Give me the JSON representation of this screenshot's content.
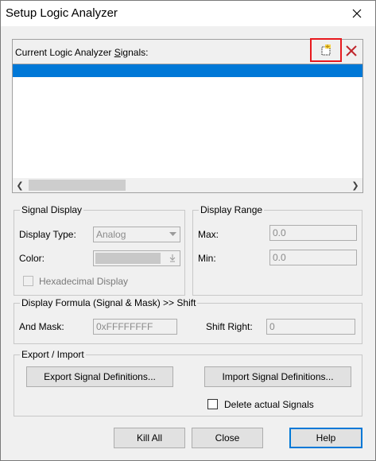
{
  "window": {
    "title": "Setup Logic Analyzer"
  },
  "signals": {
    "label_prefix": "Current Logic Analyzer ",
    "label_underlined": "S",
    "label_suffix": "ignals:",
    "items": [
      ""
    ]
  },
  "signal_display": {
    "legend": "Signal Display",
    "display_type_label": "Display Type:",
    "display_type_value": "Analog",
    "color_label": "Color:",
    "hex_label": "Hexadecimal Display"
  },
  "display_range": {
    "legend": "Display Range",
    "max_label": "Max:",
    "max_value": "0.0",
    "min_label": "Min:",
    "min_value": "0.0"
  },
  "formula": {
    "legend": "Display Formula (Signal & Mask) >> Shift",
    "and_mask_label": "And Mask:",
    "and_mask_value": "0xFFFFFFFF",
    "shift_right_label": "Shift Right:",
    "shift_right_value": "0"
  },
  "export_import": {
    "legend": "Export / Import",
    "export_button": "Export Signal Definitions...",
    "import_button": "Import Signal Definitions...",
    "delete_label": "Delete actual Signals"
  },
  "footer": {
    "kill_all": "Kill All",
    "close": "Close",
    "help": "Help"
  },
  "colors": {
    "selection": "#0078d7",
    "highlight_box": "#e8191e",
    "delete_icon": "#c0262c",
    "color_swatch": "#c8c8c8"
  }
}
